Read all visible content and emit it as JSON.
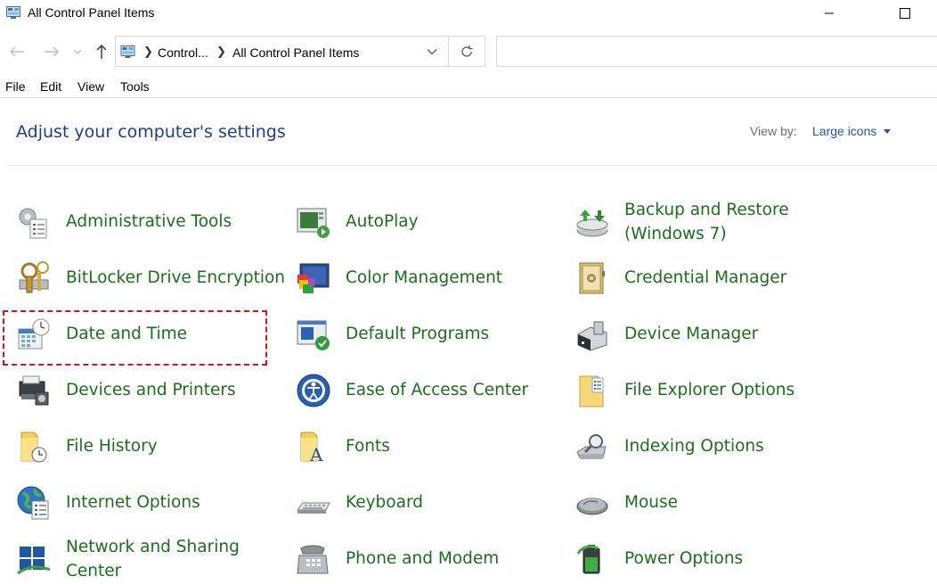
{
  "window": {
    "title": "All Control Panel Items",
    "icon": "control-panel-icon"
  },
  "address": {
    "crumbs": [
      "Control...",
      "All Control Panel Items"
    ],
    "search_placeholder": ""
  },
  "menu": {
    "file": "File",
    "edit": "Edit",
    "view": "View",
    "tools": "Tools"
  },
  "header": {
    "title": "Adjust your computer's settings",
    "view_by_label": "View by:",
    "view_by_value": "Large icons"
  },
  "colors": {
    "item_text": "#1b6f1b",
    "heading": "#1e3e8e",
    "link": "#1a57b8",
    "highlight_border": "#e01010"
  },
  "items": [
    {
      "line1": "Administrative Tools",
      "line2": "",
      "icon": "administrative-tools-icon"
    },
    {
      "line1": "AutoPlay",
      "line2": "",
      "icon": "autoplay-icon"
    },
    {
      "line1": "Backup and Restore",
      "line2": "(Windows 7)",
      "icon": "backup-restore-icon"
    },
    {
      "line1": "BitLocker Drive Encryption",
      "line2": "",
      "icon": "bitlocker-icon"
    },
    {
      "line1": "Color Management",
      "line2": "",
      "icon": "color-management-icon"
    },
    {
      "line1": "Credential Manager",
      "line2": "",
      "icon": "credential-manager-icon"
    },
    {
      "line1": "Date and Time",
      "line2": "",
      "icon": "date-time-icon"
    },
    {
      "line1": "Default Programs",
      "line2": "",
      "icon": "default-programs-icon"
    },
    {
      "line1": "Device Manager",
      "line2": "",
      "icon": "device-manager-icon"
    },
    {
      "line1": "Devices and Printers",
      "line2": "",
      "icon": "devices-printers-icon"
    },
    {
      "line1": "Ease of Access Center",
      "line2": "",
      "icon": "ease-of-access-icon"
    },
    {
      "line1": "File Explorer Options",
      "line2": "",
      "icon": "file-explorer-options-icon"
    },
    {
      "line1": "File History",
      "line2": "",
      "icon": "file-history-icon"
    },
    {
      "line1": "Fonts",
      "line2": "",
      "icon": "fonts-icon"
    },
    {
      "line1": "Indexing Options",
      "line2": "",
      "icon": "indexing-options-icon"
    },
    {
      "line1": "Internet Options",
      "line2": "",
      "icon": "internet-options-icon"
    },
    {
      "line1": "Keyboard",
      "line2": "",
      "icon": "keyboard-icon"
    },
    {
      "line1": "Mouse",
      "line2": "",
      "icon": "mouse-icon"
    },
    {
      "line1": "Network and Sharing",
      "line2": "Center",
      "icon": "network-sharing-icon"
    },
    {
      "line1": "Phone and Modem",
      "line2": "",
      "icon": "phone-modem-icon"
    },
    {
      "line1": "Power Options",
      "line2": "",
      "icon": "power-options-icon"
    }
  ]
}
